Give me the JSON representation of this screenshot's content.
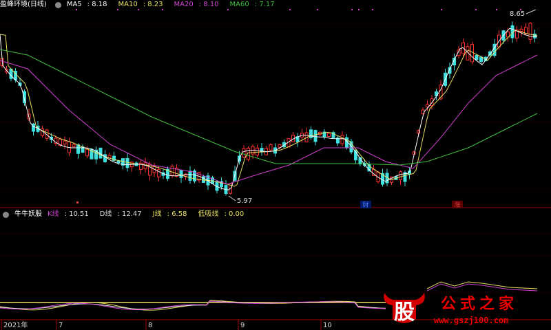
{
  "chart_data": {
    "type": "candlestick",
    "main_panel": {
      "title": "盈峰环境(日线)",
      "ma_labels": [
        {
          "name": "MA5",
          "value": "8.18",
          "color": "#ffffff"
        },
        {
          "name": "MA10",
          "value": "8.23",
          "color": "#e8e060"
        },
        {
          "name": "MA20",
          "value": "8.10",
          "color": "#d040d0"
        },
        {
          "name": "MA60",
          "value": "7.17",
          "color": "#40c040"
        }
      ],
      "price_range": [
        5.8,
        8.9
      ],
      "high_label": "8.65",
      "low_label": "5.97",
      "markers": [
        {
          "text": "财",
          "color": "#4a7cff"
        },
        {
          "text": "涨",
          "color": "#e04040"
        }
      ],
      "up_color": "#ff3030",
      "down_color": "#40e0e0"
    },
    "indicator_panel": {
      "title": "牛牛妖股",
      "labels": [
        {
          "name": "K线",
          "value": "10.51",
          "color": "#e8e8e8",
          "name_color": "#d040d0"
        },
        {
          "name": "D线",
          "value": "12.47",
          "color": "#e8e8e8",
          "name_color": "#e8e8e8"
        },
        {
          "name": "J线",
          "value": "6.58",
          "color": "#e8e060",
          "name_color": "#e8e060"
        },
        {
          "name": "低吸线",
          "value": "0.00",
          "color": "#e8e060",
          "name_color": "#e8e060"
        }
      ],
      "baseline_color": "#e8e060"
    },
    "x_axis_labels": [
      "2021年",
      "7",
      "8",
      "9",
      "10"
    ]
  },
  "watermark": {
    "title": "公式之家",
    "site": "www.gszj100.com",
    "badge": "股"
  }
}
